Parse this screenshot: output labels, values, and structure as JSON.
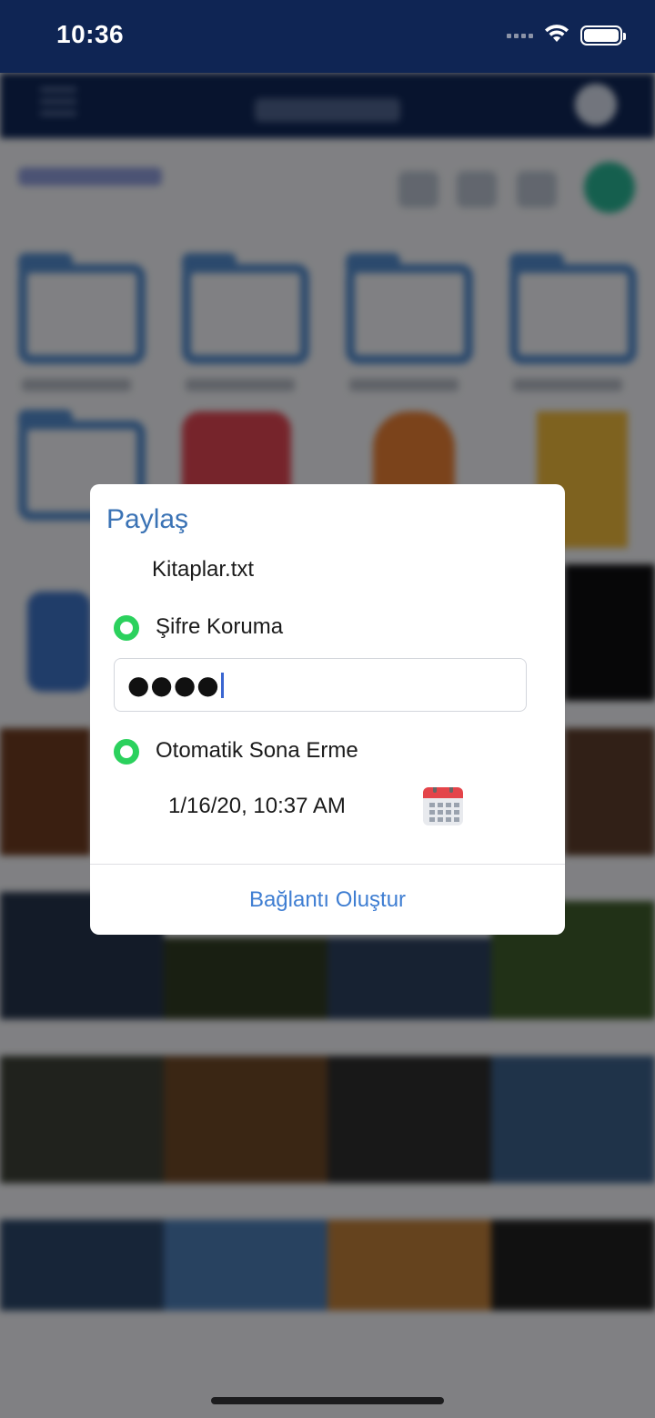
{
  "status_bar": {
    "time": "10:36",
    "icons": [
      "signal-icon",
      "wifi-icon",
      "battery-icon"
    ]
  },
  "colors": {
    "header_bg": "#0f2554",
    "accent_blue": "#3b73b5",
    "link_blue": "#3f7ed2",
    "radio_green": "#2bd15d",
    "calendar_red": "#e4444a"
  },
  "share_dialog": {
    "title": "Paylaş",
    "file_name": "Kitaplar.txt",
    "password_protection_label": "Şifre Koruma",
    "password_value": "●●●●",
    "auto_expire_label": "Otomatik Sona Erme",
    "expire_date": "1/16/20, 10:37 AM",
    "calendar_icon": "calendar-icon",
    "create_link_label": "Bağlantı Oluştur"
  }
}
